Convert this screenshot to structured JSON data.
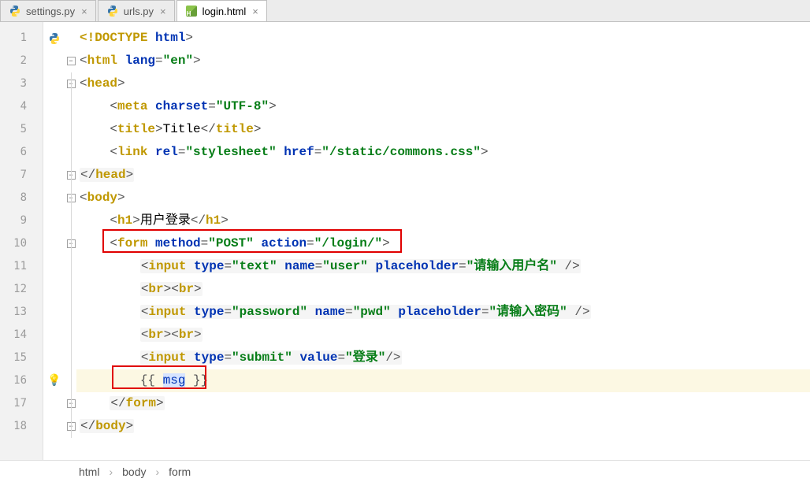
{
  "tabs": [
    {
      "label": "settings.py",
      "active": false,
      "type": "py"
    },
    {
      "label": "urls.py",
      "active": false,
      "type": "py"
    },
    {
      "label": "login.html",
      "active": true,
      "type": "html"
    }
  ],
  "code": {
    "l1": {
      "doctype": "<!DOCTYPE ",
      "kw": "html",
      "close": ">"
    },
    "l2": {
      "open": "<",
      "tag": "html ",
      "attr": "lang",
      "eq": "=",
      "val": "\"en\"",
      "close": ">"
    },
    "l3": {
      "open": "<",
      "tag": "head",
      "close": ">"
    },
    "l4": {
      "open": "<",
      "tag": "meta ",
      "attr": "charset",
      "eq": "=",
      "val": "\"UTF-8\"",
      "close": ">"
    },
    "l5": {
      "open": "<",
      "tag": "title",
      "close1": ">",
      "text": "Title",
      "open2": "</",
      "tag2": "title",
      "close2": ">"
    },
    "l6": {
      "open": "<",
      "tag": "link ",
      "attr1": "rel",
      "val1": "\"stylesheet\"",
      "attr2": "href",
      "val2": "\"/static/commons.css\"",
      "close": ">"
    },
    "l7": {
      "open": "</",
      "tag": "head",
      "close": ">"
    },
    "l8": {
      "open": "<",
      "tag": "body",
      "close": ">"
    },
    "l9": {
      "open": "<",
      "tag": "h1",
      "close1": ">",
      "text": "用户登录",
      "open2": "</",
      "tag2": "h1",
      "close2": ">"
    },
    "l10": {
      "open": "<",
      "tag": "form ",
      "attr1": "method",
      "val1": "\"POST\"",
      "attr2": "action",
      "val2": "\"/login/\"",
      "close": ">"
    },
    "l11": {
      "open": "<",
      "tag": "input ",
      "attr1": "type",
      "val1": "\"text\"",
      "attr2": "name",
      "val2": "\"user\"",
      "attr3": "placeholder",
      "val3": "\"请输入用户名\"",
      "close": " />"
    },
    "l12": {
      "open1": "<",
      "tag1": "br",
      "close1": ">",
      "open2": "<",
      "tag2": "br",
      "close2": ">"
    },
    "l13": {
      "open": "<",
      "tag": "input ",
      "attr1": "type",
      "val1": "\"password\"",
      "attr2": "name",
      "val2": "\"pwd\"",
      "attr3": "placeholder",
      "val3": "\"请输入密码\"",
      "close": " />"
    },
    "l14": {
      "open1": "<",
      "tag1": "br",
      "close1": ">",
      "open2": "<",
      "tag2": "br",
      "close2": ">"
    },
    "l15": {
      "open": "<",
      "tag": "input ",
      "attr1": "type",
      "val1": "\"submit\"",
      "attr2": "value",
      "val2": "\"登录\"",
      "close": "/>"
    },
    "l16": {
      "b1": "{{ ",
      "var": "msg",
      "b2": " }}"
    },
    "l17": {
      "open": "</",
      "tag": "form",
      "close": ">"
    },
    "l18": {
      "open": "</",
      "tag": "body",
      "close": ">"
    }
  },
  "breadcrumb": {
    "p1": "html",
    "p2": "body",
    "p3": "form"
  },
  "line_numbers": [
    "1",
    "2",
    "3",
    "4",
    "5",
    "6",
    "7",
    "8",
    "9",
    "10",
    "11",
    "12",
    "13",
    "14",
    "15",
    "16",
    "17",
    "18"
  ]
}
